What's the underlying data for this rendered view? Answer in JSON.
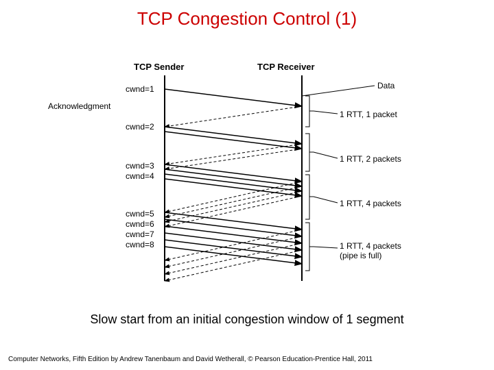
{
  "title": "TCP Congestion Control (1)",
  "caption": "Slow start from an initial congestion window of 1 segment",
  "footer": "Computer Networks, Fifth Edition by Andrew Tanenbaum and David Wetherall, © Pearson Education-Prentice Hall, 2011",
  "diagram": {
    "sender_label": "TCP Sender",
    "receiver_label": "TCP Receiver",
    "ack_label": "Acknowledgment",
    "data_label": "Data",
    "cwnd": [
      "cwnd=1",
      "cwnd=2",
      "cwnd=3",
      "cwnd=4",
      "cwnd=5",
      "cwnd=6",
      "cwnd=7",
      "cwnd=8"
    ],
    "rtt": [
      "1 RTT, 1 packet",
      "1 RTT, 2 packets",
      "1 RTT, 4 packets",
      "1 RTT, 4 packets\n(pipe is full)"
    ]
  }
}
